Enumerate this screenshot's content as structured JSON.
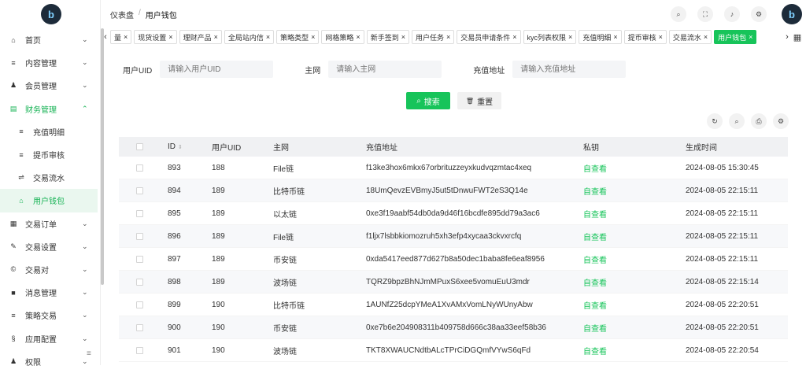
{
  "sidebar": {
    "logo": "b",
    "items": [
      {
        "icon": "home-icon",
        "glyph": "⌂",
        "label": "首页",
        "chev": "⌄"
      },
      {
        "icon": "list-icon",
        "glyph": "≡",
        "label": "内容管理",
        "chev": "⌄"
      },
      {
        "icon": "user-icon",
        "glyph": "♟",
        "label": "会员管理",
        "chev": "⌄"
      },
      {
        "icon": "finance-icon",
        "glyph": "▤",
        "label": "财务管理",
        "chev": "⌃"
      },
      {
        "icon": "list-icon",
        "glyph": "≡",
        "label": "充值明细"
      },
      {
        "icon": "list-icon",
        "glyph": "≡",
        "label": "提币审核"
      },
      {
        "icon": "flow-icon",
        "glyph": "⇌",
        "label": "交易流水"
      },
      {
        "icon": "home-icon",
        "glyph": "⌂",
        "label": "用户钱包"
      },
      {
        "icon": "order-icon",
        "glyph": "▦",
        "label": "交易订单",
        "chev": "⌄"
      },
      {
        "icon": "wrench-icon",
        "glyph": "✎",
        "label": "交易设置",
        "chev": "⌄"
      },
      {
        "icon": "pair-icon",
        "glyph": "©",
        "label": "交易对",
        "chev": "⌄"
      },
      {
        "icon": "message-icon",
        "glyph": "■",
        "label": "消息管理",
        "chev": "⌄"
      },
      {
        "icon": "strategy-icon",
        "glyph": "≡",
        "label": "策略交易",
        "chev": "⌄"
      },
      {
        "icon": "config-icon",
        "glyph": "§",
        "label": "应用配置",
        "chev": "⌄"
      },
      {
        "icon": "permission-icon",
        "glyph": "♟",
        "label": "权限",
        "chev": "⌄"
      }
    ],
    "collapse_glyph": "≡"
  },
  "header": {
    "breadcrumb": [
      "仪表盘",
      "用户钱包"
    ],
    "separator": "/",
    "icons": [
      "search-icon",
      "fullscreen-icon",
      "bell-icon",
      "settings-icon"
    ],
    "icon_glyphs": [
      "⌕",
      "⛶",
      "♪",
      "⚙"
    ],
    "avatar": "b"
  },
  "tabs": {
    "left_arrow": "‹",
    "right_arrow": "›",
    "menu_glyph": "▦",
    "items": [
      "量",
      "现货设置",
      "理财产品",
      "全局站内信",
      "策略类型",
      "网格策略",
      "新手签到",
      "用户任务",
      "交易员申请条件",
      "kyc列表权限",
      "充值明细",
      "提币审核",
      "交易流水",
      "用户钱包"
    ],
    "active_index": 13,
    "close": "×"
  },
  "filter": {
    "uid_label": "用户UID",
    "uid_placeholder": "请输入用户UID",
    "chain_label": "主网",
    "chain_placeholder": "请输入主网",
    "addr_label": "充值地址",
    "addr_placeholder": "请输入充值地址",
    "search_label": "搜索",
    "search_glyph": "⌕",
    "reset_label": "重置",
    "reset_glyph": "🗑"
  },
  "tools": [
    "↻",
    "⌕",
    "⎙",
    "⚙"
  ],
  "table": {
    "headers": [
      "ID",
      "用户UID",
      "主网",
      "充值地址",
      "私钥",
      "生成时间"
    ],
    "sort_glyph": "⇕",
    "rows": [
      {
        "id": "893",
        "uid": "188",
        "chain": "File链",
        "address": "f13ke3hox6mkx67orbrituzzeyxkudvqzmtac4xeq",
        "key": "自查看",
        "time": "2024-08-05 15:30:45"
      },
      {
        "id": "894",
        "uid": "189",
        "chain": "比特币链",
        "address": "18UmQevzEVBmyJ5ut5tDnwuFWT2eS3Q14e",
        "key": "自查看",
        "time": "2024-08-05 22:15:11"
      },
      {
        "id": "895",
        "uid": "189",
        "chain": "以太链",
        "address": "0xe3f19aabf54db0da9d46f16bcdfe895dd79a3ac6",
        "key": "自查看",
        "time": "2024-08-05 22:15:11"
      },
      {
        "id": "896",
        "uid": "189",
        "chain": "File链",
        "address": "f1ljx7lsbbkiomozruh5xh3efp4xycaa3ckvxrcfq",
        "key": "自查看",
        "time": "2024-08-05 22:15:11"
      },
      {
        "id": "897",
        "uid": "189",
        "chain": "币安链",
        "address": "0xda5417eed877d627b8a50dec1baba8fe6eaf8956",
        "key": "自查看",
        "time": "2024-08-05 22:15:11"
      },
      {
        "id": "898",
        "uid": "189",
        "chain": "波场链",
        "address": "TQRZ9bpzBhNJmMPuxS6xee5vomuEuU3mdr",
        "key": "自查看",
        "time": "2024-08-05 22:15:14"
      },
      {
        "id": "899",
        "uid": "190",
        "chain": "比特币链",
        "address": "1AUNfZ25dcpYMeA1XvAMxVomLNyWUnyAbw",
        "key": "自查看",
        "time": "2024-08-05 22:20:51"
      },
      {
        "id": "900",
        "uid": "190",
        "chain": "币安链",
        "address": "0xe7b6e204908311b409758d666c38aa33eef58b36",
        "key": "自查看",
        "time": "2024-08-05 22:20:51"
      },
      {
        "id": "901",
        "uid": "190",
        "chain": "波场链",
        "address": "TKT8XWAUCNdtbALcTPrCiDGQmfVYwS6qFd",
        "key": "自查看",
        "time": "2024-08-05 22:20:54"
      }
    ]
  }
}
